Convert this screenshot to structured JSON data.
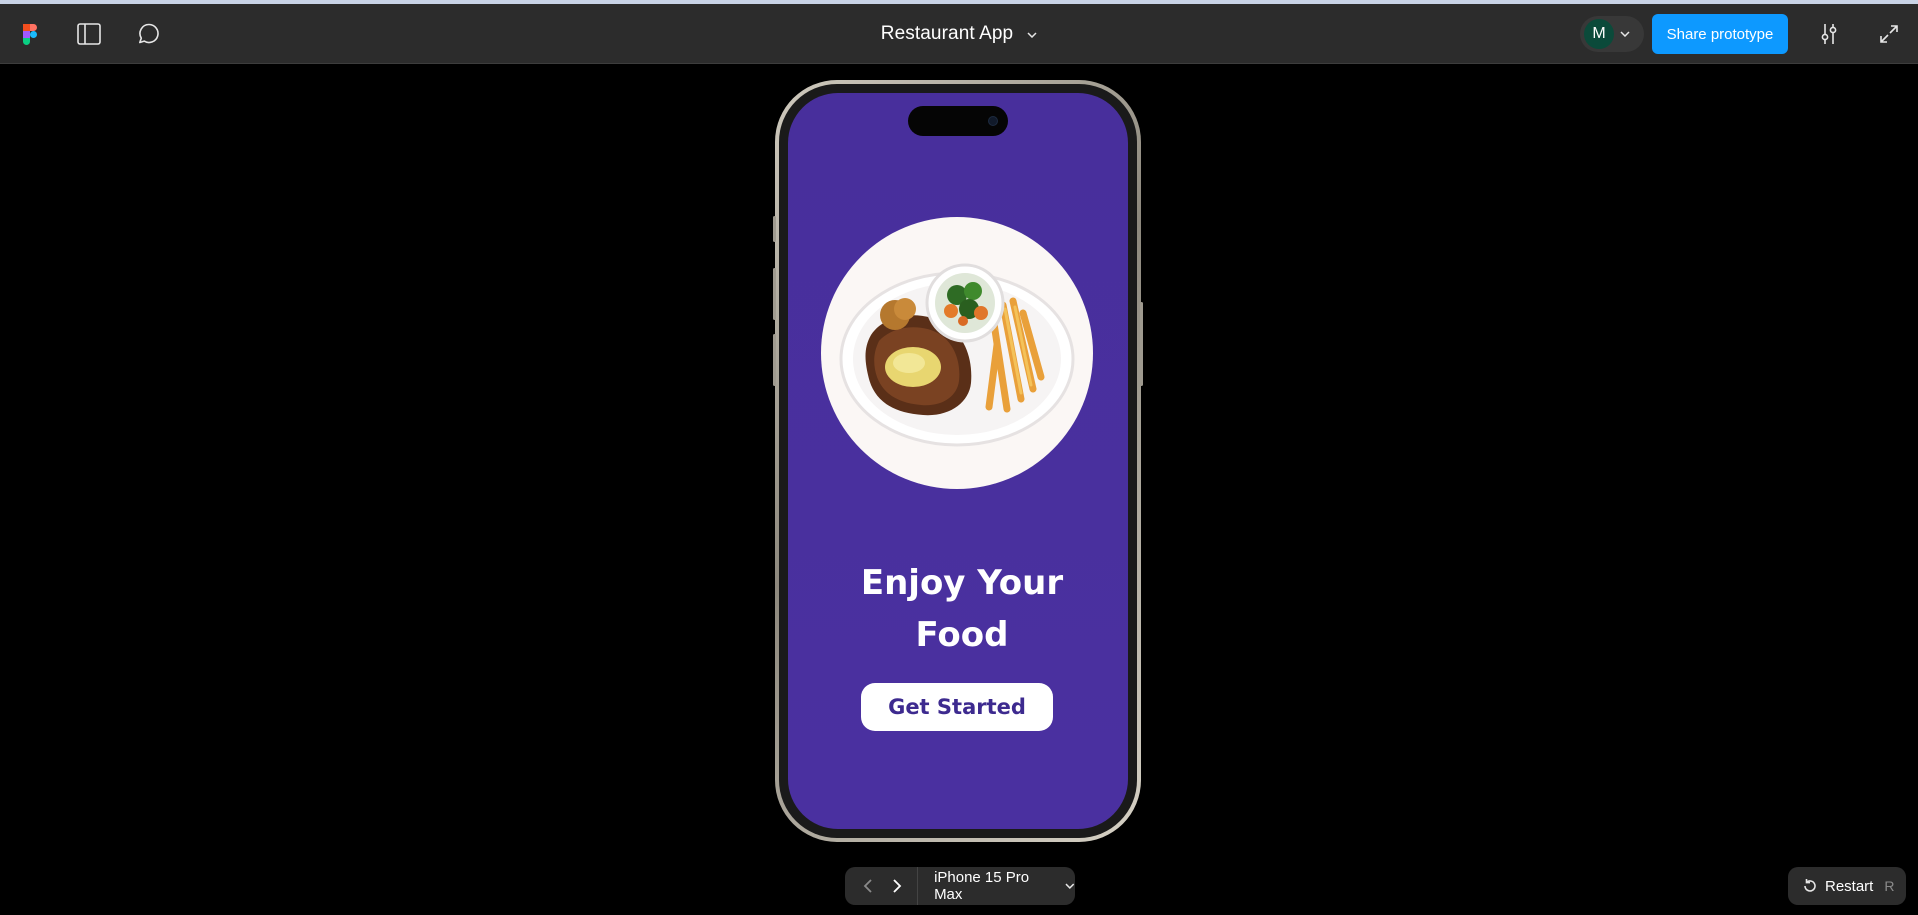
{
  "toolbar": {
    "figma_logo_icon": "figma-logo-icon",
    "panel_icon": "sidebar-panel-icon",
    "comment_icon": "comment-icon",
    "title": "Restaurant App",
    "title_dropdown_icon": "chevron-down-icon",
    "avatar_initial": "M",
    "avatar_color": "#0b4a3a",
    "share_label": "Share prototype",
    "share_color": "#0d99ff",
    "settings_icon": "sliders-icon",
    "expand_icon": "expand-icon"
  },
  "app_screen": {
    "background_color": "#482f9c",
    "image": "plate with steak, fries and vegetables",
    "title_line1": "Enjoy Your",
    "title_line2": "Food",
    "cta_label": "Get Started",
    "cta_text_color": "#3d2a8f"
  },
  "footer": {
    "prev_icon": "chevron-left-icon",
    "next_icon": "chevron-right-icon",
    "device_label": "iPhone 15 Pro Max",
    "restart_label": "Restart",
    "restart_shortcut": "R"
  }
}
